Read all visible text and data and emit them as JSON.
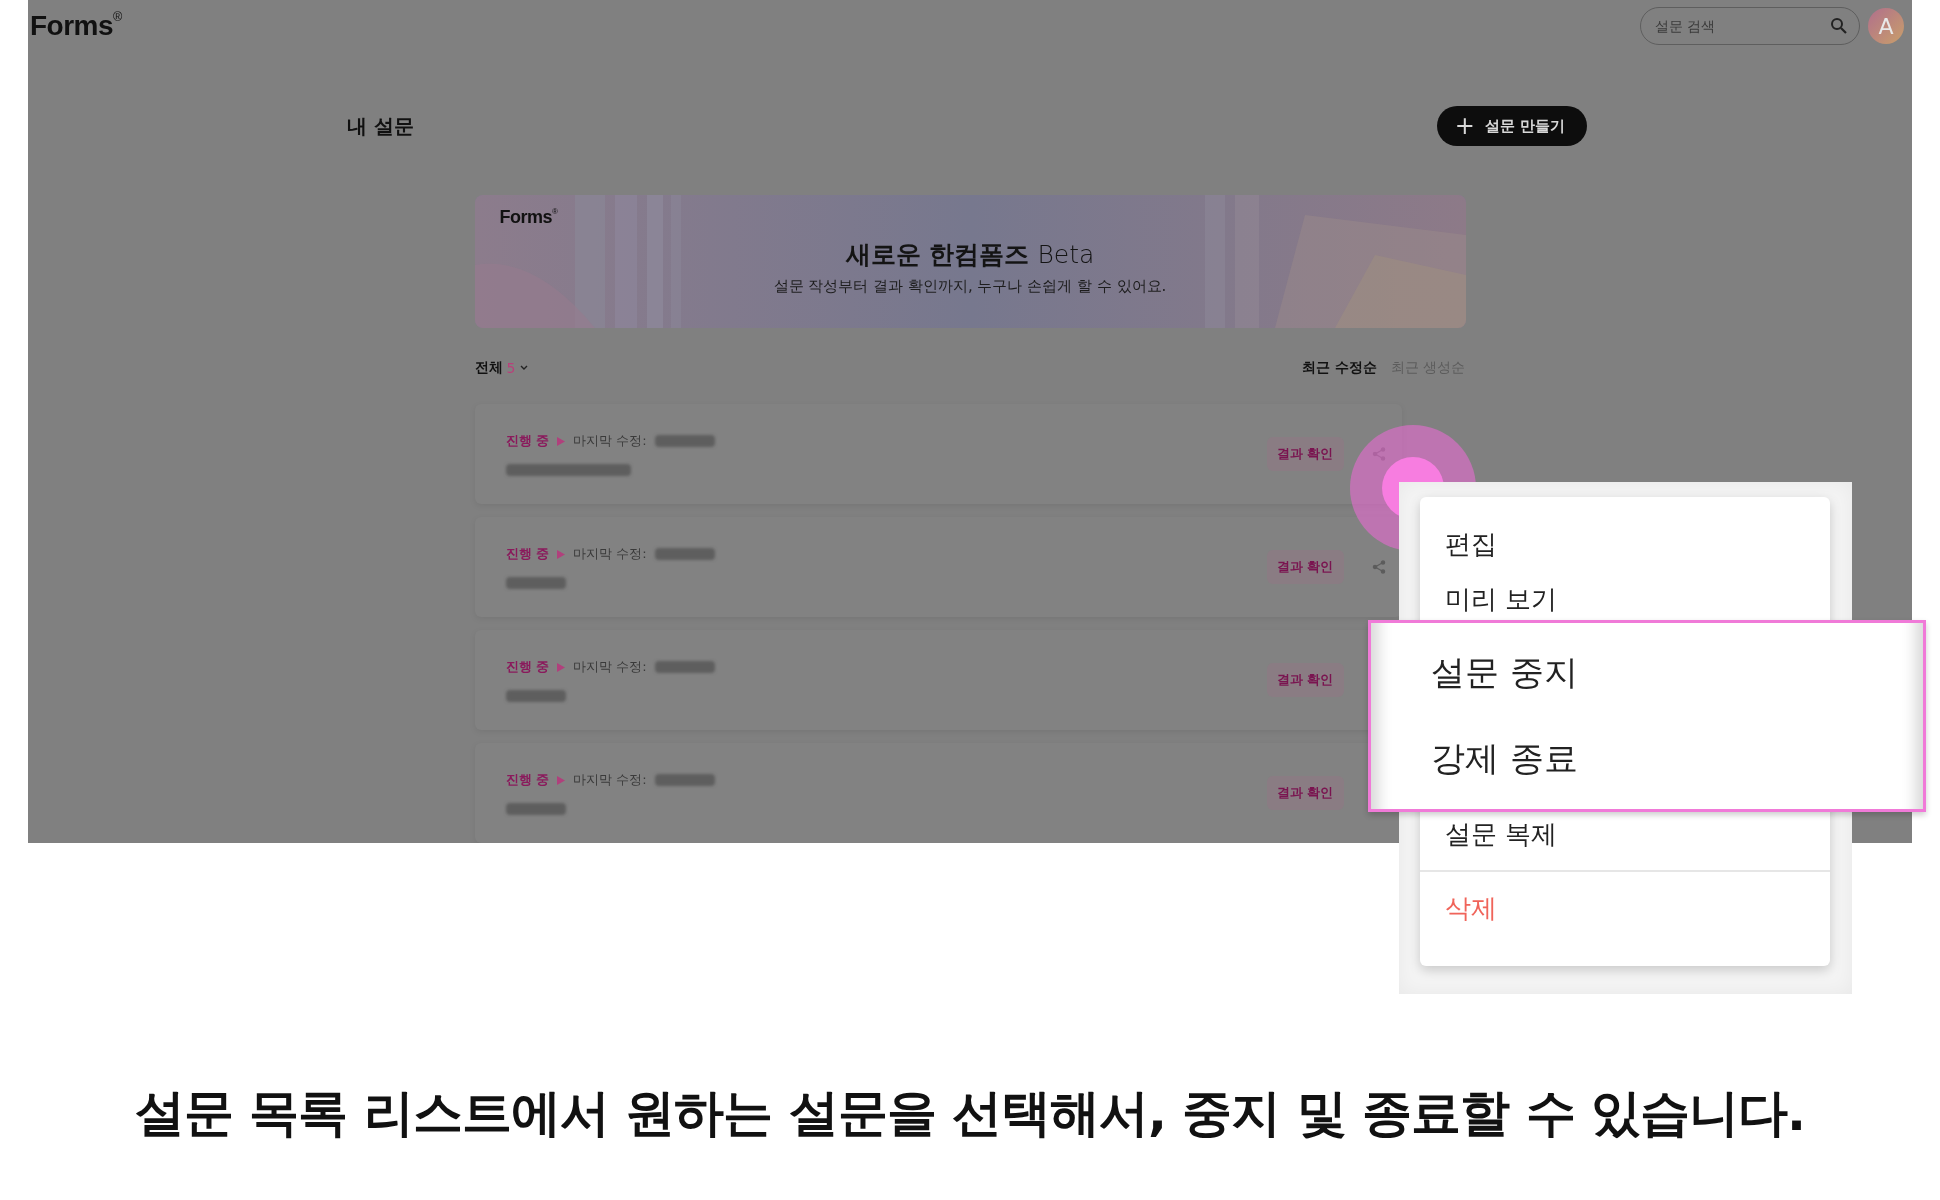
{
  "header": {
    "logo": "Forms",
    "logo_mark": "®",
    "search": {
      "placeholder": "설문 검색"
    },
    "avatar": "A"
  },
  "page_title": "내 설문",
  "create_button": {
    "icon": "+",
    "label": "설문 만들기"
  },
  "banner": {
    "logo": "Forms",
    "logo_mark": "®",
    "title": "새로운 한컴폼즈",
    "title_suffix": "Beta",
    "subtitle": "설문 작성부터 결과 확인까지, 누구나 손쉽게 할 수 있어요."
  },
  "filter": {
    "label": "전체",
    "count": "5"
  },
  "sort_options": [
    {
      "label": "최근 수정순",
      "selected": true
    },
    {
      "label": "최근 생성순",
      "selected": false
    }
  ],
  "surveys": [
    {
      "status": "진행 중",
      "modified_label": "마지막 수정:",
      "result_button": "결과 확인",
      "share_icon": true
    },
    {
      "status": "진행 중",
      "modified_label": "마지막 수정:",
      "result_button": "결과 확인",
      "share_icon": true
    },
    {
      "status": "진행 중",
      "modified_label": "마지막 수정:",
      "result_button": "결과 확인",
      "share_icon": false
    },
    {
      "status": "진행 중",
      "modified_label": "마지막 수정:",
      "result_button": "결과 확인",
      "share_icon": false
    }
  ],
  "menu": {
    "items": [
      {
        "kind": "item",
        "label": "편집"
      },
      {
        "kind": "item",
        "label": "미리 보기"
      },
      {
        "kind": "gap"
      },
      {
        "kind": "item",
        "label": "설문 복제"
      },
      {
        "kind": "divider"
      },
      {
        "kind": "danger",
        "label": "삭제"
      }
    ]
  },
  "callout": {
    "items": [
      "설문 중지",
      "강제 종료"
    ]
  },
  "caption": "설문 목록 리스트에서 원하는 설문을 선택해서, 중지 및 종료할 수 있습니다."
}
